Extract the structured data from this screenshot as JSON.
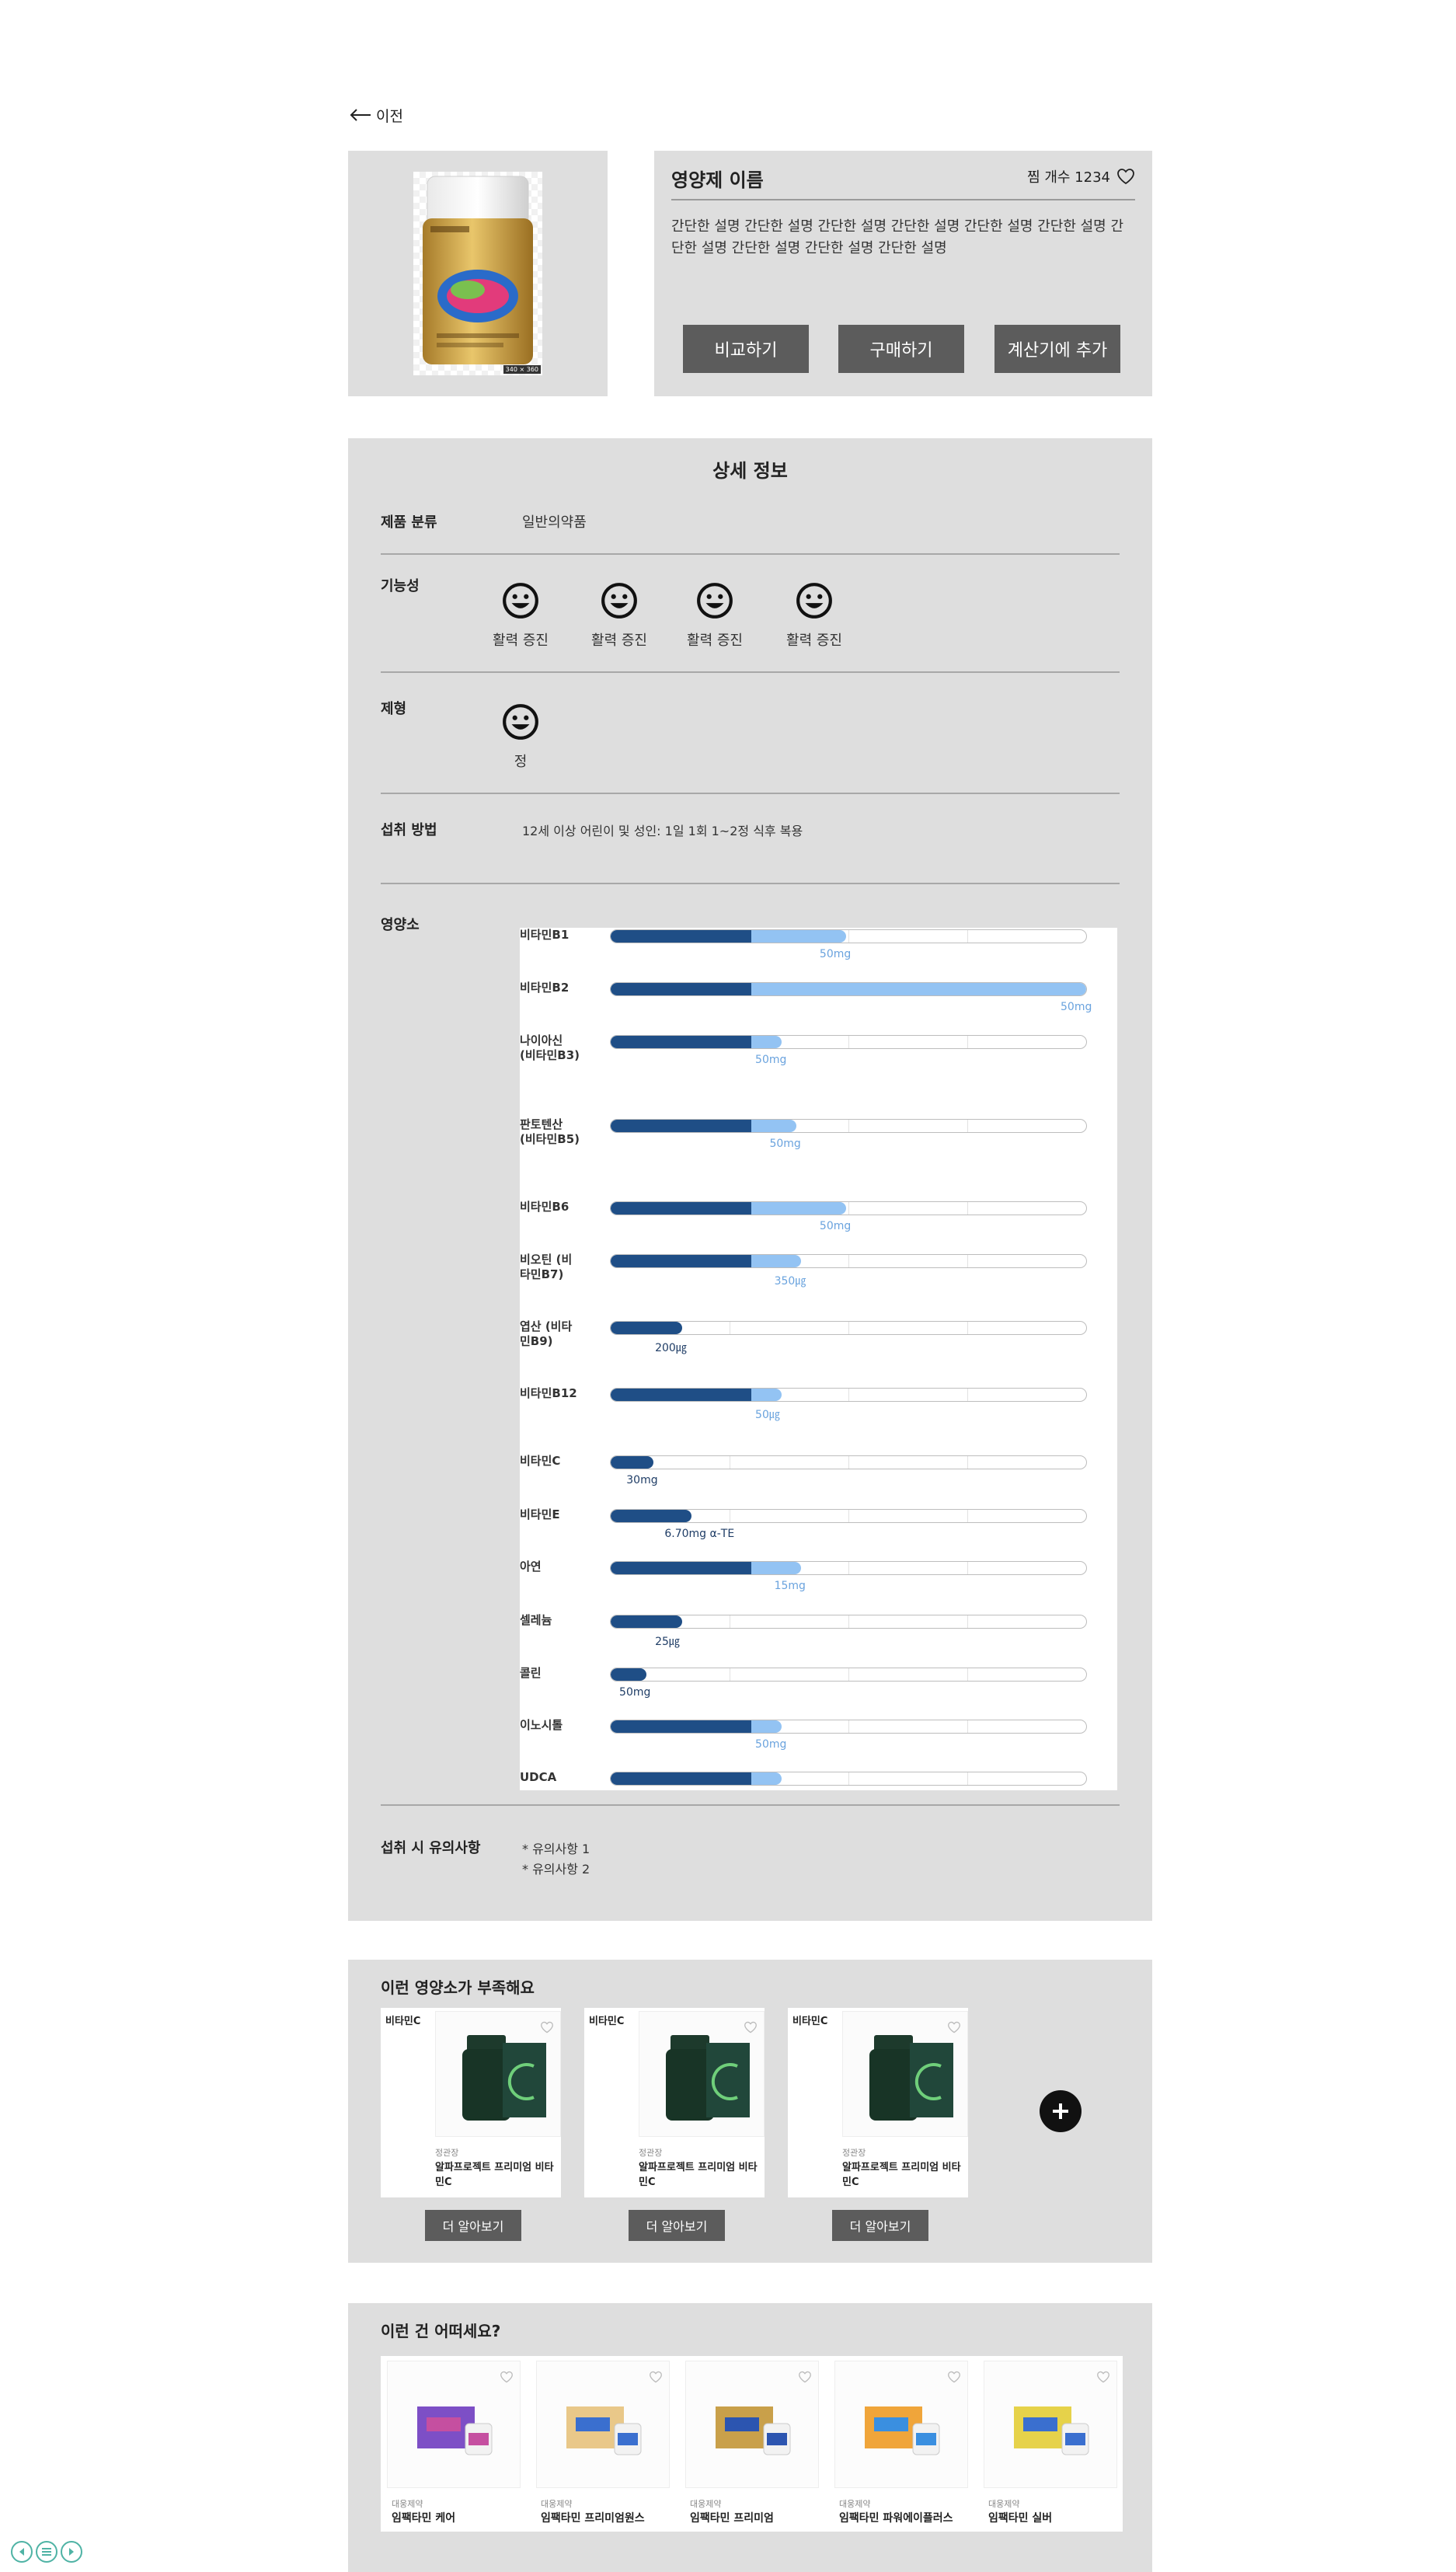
{
  "back": {
    "label": "이전"
  },
  "product": {
    "name": "영양제 이름",
    "wish_label": "찜 개수 1234",
    "description": "간단한 설명 간단한 설명 간단한 설명 간단한 설명 간단한 설명 간단한 설명 간단한 설명 간단한 설명 간단한 설명 간단한 설명",
    "image_size_tag": "340 × 360",
    "buttons": {
      "compare": "비교하기",
      "buy": "구매하기",
      "calculator": "계산기에 추가"
    }
  },
  "detail": {
    "title": "상세 정보",
    "category_label": "제품 분류",
    "category_value": "일반의약품",
    "function_label": "기능성",
    "functions": [
      "활력 증진",
      "활력 증진",
      "활력 증진",
      "활력 증진"
    ],
    "form_label": "제형",
    "forms": [
      "정"
    ],
    "intake_label": "섭취 방법",
    "intake_value": "12세 이상 어린이 및 성인: 1일 1회 1~2정 식후 복용",
    "nutrients_label": "영양소",
    "caution_label": "섭취 시 유의사항",
    "cautions": [
      "* 유의사항 1",
      "* 유의사항 2"
    ]
  },
  "chart_data": {
    "type": "bar",
    "orientation": "horizontal",
    "categories": [
      "비타민B1",
      "비타민B2",
      "나이아신 (비타민B3)",
      "판토텐산 (비타민B5)",
      "비타민B6",
      "비오틴 (비타민B7)",
      "엽산 (비타민B9)",
      "비타민B12",
      "비타민C",
      "비타민E",
      "아연",
      "셀레늄",
      "콜린",
      "이노시톨",
      "UDCA"
    ],
    "amount_labels": [
      "50mg",
      "50mg",
      "50mg",
      "50mg",
      "50mg",
      "350㎍",
      "200㎍",
      "50㎍",
      "30mg",
      "6.70mg α-TE",
      "15mg",
      "25㎍",
      "50mg",
      "50mg",
      ""
    ],
    "fill_fraction": [
      0.495,
      1.0,
      0.36,
      0.39,
      0.495,
      0.4,
      0.15,
      0.36,
      0.09,
      0.17,
      0.4,
      0.15,
      0.075,
      0.36,
      0.36
    ],
    "dark_fraction": [
      0.295,
      0.295,
      0.295,
      0.295,
      0.295,
      0.295,
      0.15,
      0.295,
      0.09,
      0.17,
      0.295,
      0.15,
      0.075,
      0.295,
      0.295
    ],
    "colors": {
      "base": "#1f4e86",
      "excess": "#93c3f3",
      "label_excess": "#6aa3de",
      "label_base": "#1f3d66"
    }
  },
  "deficient": {
    "title": "이런 영양소가 부족해요",
    "items": [
      {
        "badge": "비타민C",
        "brand": "정관장",
        "name": "알파프로젝트 프리미엄 비타민C",
        "more": "더 알아보기"
      },
      {
        "badge": "비타민C",
        "brand": "정관장",
        "name": "알파프로젝트 프리미엄 비타민C",
        "more": "더 알아보기"
      },
      {
        "badge": "비타민C",
        "brand": "정관장",
        "name": "알파프로젝트 프리미엄 비타민C",
        "more": "더 알아보기"
      }
    ]
  },
  "suggest": {
    "title": "이런 건 어떠세요?",
    "items": [
      {
        "brand": "대웅제약",
        "name": "임팩타민 케어"
      },
      {
        "brand": "대웅제약",
        "name": "임팩타민 프리미엄원스"
      },
      {
        "brand": "대웅제약",
        "name": "임팩타민 프리미엄"
      },
      {
        "brand": "대웅제약",
        "name": "임팩타민 파워에이플러스"
      },
      {
        "brand": "대웅제약",
        "name": "임팩타민 실버"
      }
    ]
  }
}
